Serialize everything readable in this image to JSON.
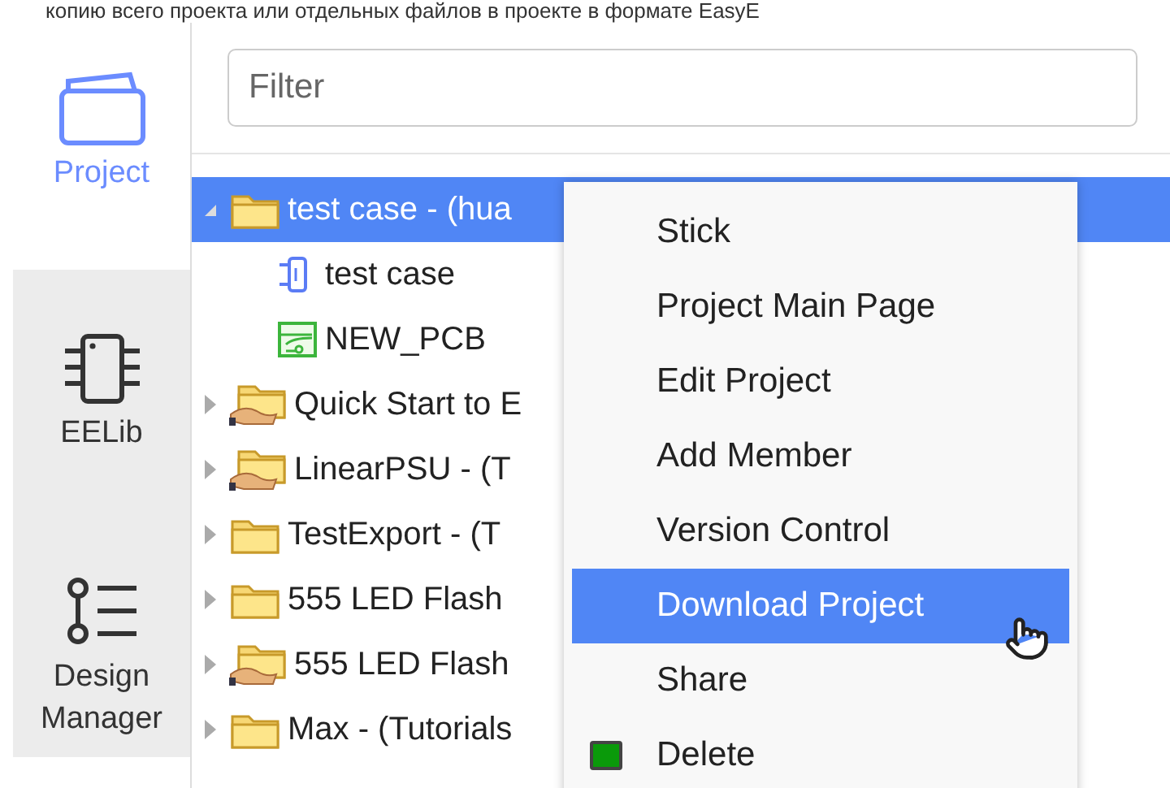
{
  "intro_text": "копию всего проекта или отдельных файлов в проекте в формате EasyE",
  "sidebar": {
    "items": [
      {
        "label": "Project",
        "kind": "folder",
        "selected": true
      },
      {
        "label": "EELib",
        "kind": "chip",
        "selected": false
      },
      {
        "label": "Design Manager",
        "kind": "manager",
        "selected": false
      }
    ]
  },
  "filter": {
    "placeholder": "Filter"
  },
  "tree": [
    {
      "label": "test case - (hua",
      "kind": "folder",
      "expanded": true,
      "selected": true,
      "children": [
        {
          "label": "test case",
          "kind": "schematic",
          "selected": false
        },
        {
          "label": "NEW_PCB",
          "kind": "pcb",
          "selected": false
        }
      ]
    },
    {
      "label": "Quick Start to E",
      "kind": "shared",
      "expanded": false,
      "selected": false
    },
    {
      "label": "LinearPSU - (T",
      "kind": "shared",
      "expanded": false,
      "selected": false
    },
    {
      "label": "TestExport - (T",
      "kind": "folder",
      "expanded": false,
      "selected": false
    },
    {
      "label": "555 LED Flash",
      "kind": "folder",
      "expanded": false,
      "selected": false
    },
    {
      "label": "555 LED Flash",
      "kind": "shared",
      "expanded": false,
      "selected": false
    },
    {
      "label": "Max - (Tutorials",
      "kind": "folder",
      "expanded": false,
      "selected": false
    }
  ],
  "context_menu": [
    {
      "label": "Stick",
      "kind": "plain",
      "selected": false
    },
    {
      "label": "Project Main Page",
      "kind": "plain",
      "selected": false
    },
    {
      "label": "Edit Project",
      "kind": "plain",
      "selected": false
    },
    {
      "label": "Add Member",
      "kind": "plain",
      "selected": false
    },
    {
      "label": "Version Control",
      "kind": "plain",
      "selected": false
    },
    {
      "label": "Download Project",
      "kind": "plain",
      "selected": true
    },
    {
      "label": "Share",
      "kind": "plain",
      "selected": false
    },
    {
      "label": "Delete",
      "kind": "delete",
      "selected": false
    }
  ]
}
